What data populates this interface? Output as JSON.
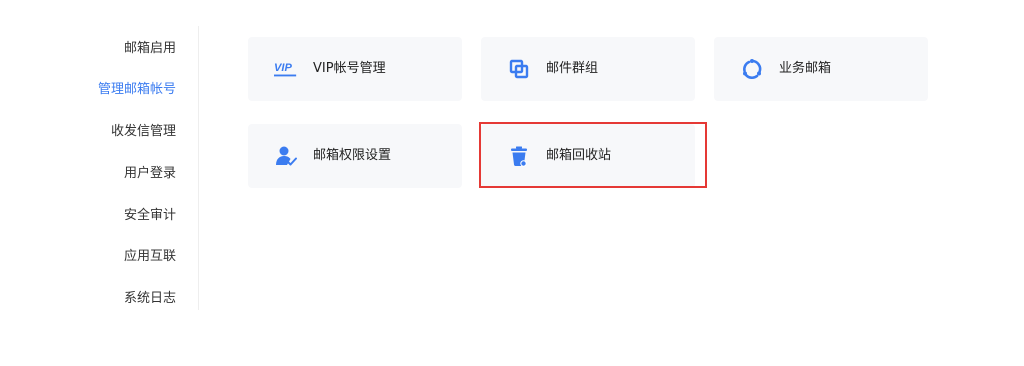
{
  "colors": {
    "accent": "#3b7cf0",
    "card_bg": "#f7f8fa",
    "highlight_border": "#e53935"
  },
  "sidebar": {
    "items": [
      {
        "label": "邮箱启用",
        "active": false
      },
      {
        "label": "管理邮箱帐号",
        "active": true
      },
      {
        "label": "收发信管理",
        "active": false
      },
      {
        "label": "用户登录",
        "active": false
      },
      {
        "label": "安全审计",
        "active": false
      },
      {
        "label": "应用互联",
        "active": false
      },
      {
        "label": "系统日志",
        "active": false
      }
    ]
  },
  "cards": [
    {
      "label": "VIP帐号管理",
      "icon": "vip-icon"
    },
    {
      "label": "邮件群组",
      "icon": "mail-group-icon"
    },
    {
      "label": "业务邮箱",
      "icon": "business-mailbox-icon"
    },
    {
      "label": "邮箱权限设置",
      "icon": "user-permission-icon"
    },
    {
      "label": "邮箱回收站",
      "icon": "trash-icon",
      "highlighted": true
    }
  ]
}
